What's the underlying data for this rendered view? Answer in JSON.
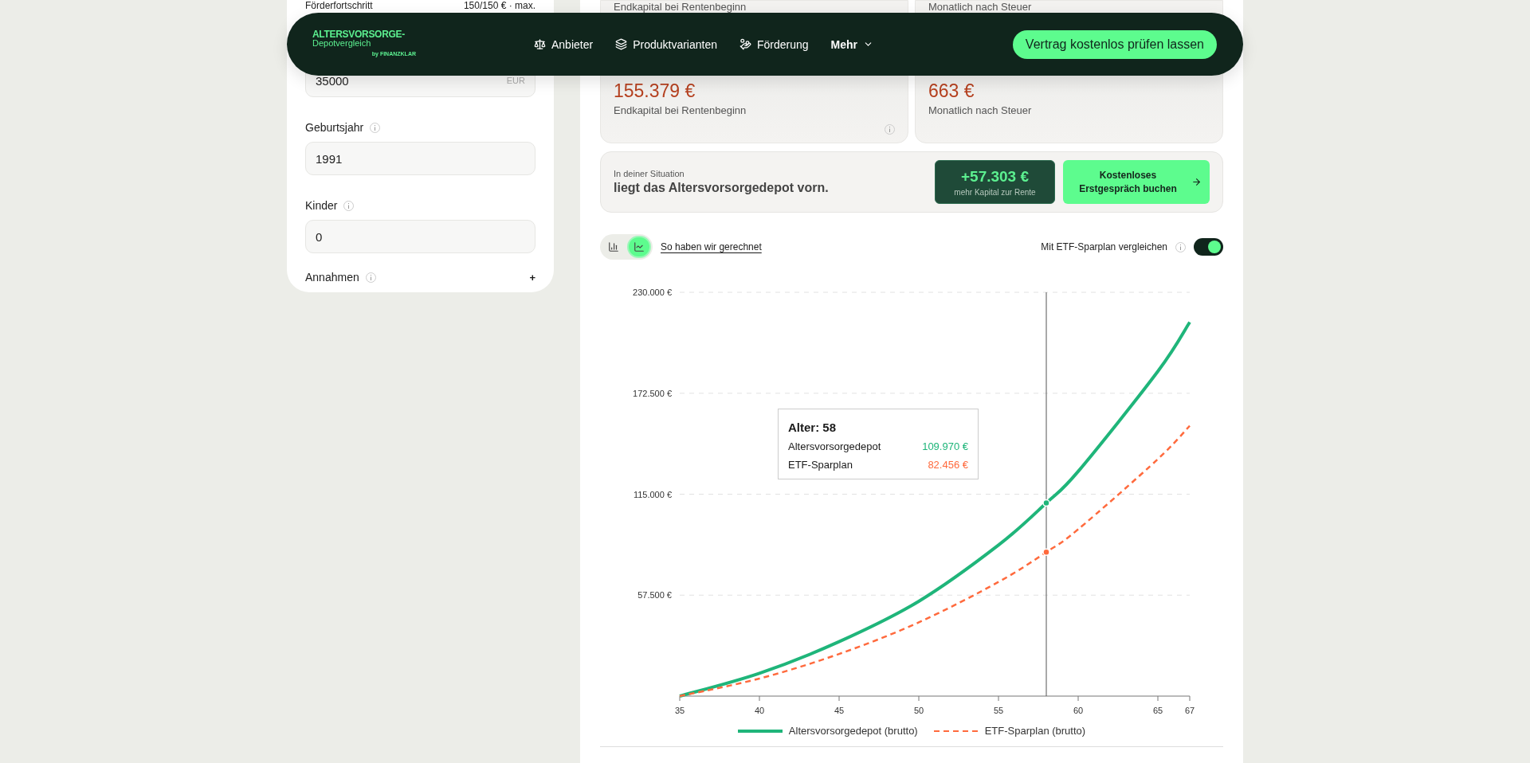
{
  "header": {
    "logo": {
      "title": "ALTERSVORSORGE-",
      "subtitle": "Depotvergleich",
      "byline": "by FINANZKLAR"
    },
    "nav": [
      {
        "label": "Anbieter",
        "kind": "scale"
      },
      {
        "label": "Produktvarianten",
        "kind": "layers"
      },
      {
        "label": "Förderung",
        "kind": "hand"
      },
      {
        "label": "Mehr",
        "kind": "dropdown"
      }
    ],
    "cta": "Vertrag kostenlos prüfen lassen"
  },
  "sidebar": {
    "progress": {
      "label": "Förderfortschritt",
      "value": "150/150 € · max."
    },
    "fields": [
      {
        "value": "35000",
        "unit": "EUR"
      },
      {
        "label": "Geburtsjahr",
        "value": "1991"
      },
      {
        "label": "Kinder",
        "value": "0"
      }
    ],
    "assumptions": {
      "label": "Annahmen",
      "toggle": "+"
    }
  },
  "summary_cards_top": [
    {
      "label": "Endkapital bei Rentenbeginn"
    },
    {
      "label": "Monatlich nach Steuer"
    }
  ],
  "summary_cards": [
    {
      "value": "155.379 €",
      "label": "Endkapital bei Rentenbeginn",
      "info": true
    },
    {
      "value": "663 €",
      "label": "Monatlich nach Steuer",
      "info": false
    }
  ],
  "situation": {
    "intro": "In deiner Situation",
    "headline": "liegt das Altersvorsorgedepot vorn.",
    "difference": "+57.303 €",
    "difference_caption": "mehr Kapital zur Rente",
    "button": "Kostenloses Erstgespräch buchen"
  },
  "chart_controls": {
    "views": [
      {
        "kind": "bar",
        "selected": false
      },
      {
        "kind": "line",
        "selected": true
      }
    ],
    "link": "So haben wir gerechnet",
    "compare_label": "Mit ETF-Sparplan vergleichen",
    "compare_on": true
  },
  "chart": {
    "chart_data": {
      "type": "line",
      "x": [
        35,
        40,
        45,
        50,
        55,
        58,
        60,
        65,
        67
      ],
      "series": [
        {
          "name": "Altersvorsorgedepot (brutto)",
          "color": "#1fb57a",
          "line_style": "solid",
          "values": [
            0,
            13000,
            31000,
            54000,
            86000,
            110000,
            128000,
            185000,
            213000
          ]
        },
        {
          "name": "ETF-Sparplan (brutto)",
          "color": "#ff6a3d",
          "line_style": "dashed",
          "values": [
            0,
            10000,
            24000,
            42000,
            65000,
            82000,
            95000,
            135000,
            154000
          ]
        }
      ],
      "grid": "y",
      "ref_lines": [
        {
          "axis": "x",
          "value": 58
        }
      ],
      "xlim": [
        35,
        67
      ],
      "ylim": [
        0,
        230000
      ],
      "xticks": [
        35,
        40,
        45,
        50,
        55,
        60,
        65,
        67
      ],
      "yticks": [
        {
          "value": 57500,
          "label": "57.500 €"
        },
        {
          "value": 115000,
          "label": "115.000 €"
        },
        {
          "value": 172500,
          "label": "172.500 €"
        },
        {
          "value": 230000,
          "label": "230.000 €"
        }
      ]
    },
    "tooltip": {
      "title": "Alter: 58",
      "rows": [
        {
          "label": "Altersvorsorgedepot",
          "value": "109.970 €",
          "color": "#1fb57a"
        },
        {
          "label": "ETF-Sparplan",
          "value": "82.456 €",
          "color": "#ff6a3d"
        }
      ]
    }
  }
}
